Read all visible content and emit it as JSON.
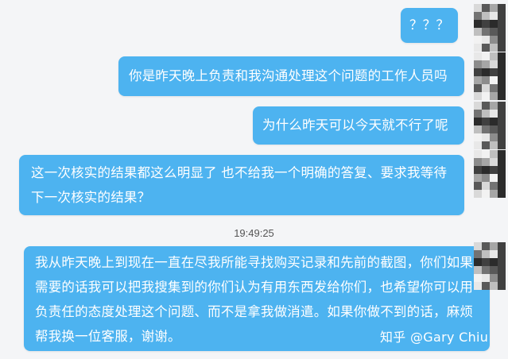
{
  "messages": [
    {
      "text": "？？？",
      "side": "right"
    },
    {
      "text": "你是昨天晚上负责和我沟通处理这个问题的工作人员吗",
      "side": "right"
    },
    {
      "text": "为什么昨天可以今天就不行了呢",
      "side": "right"
    },
    {
      "text": "这一次核实的结果都这么明显了 也不给我一个明确的答复、要求我等待下一次核实的结果？",
      "side": "right"
    },
    {
      "text": "我从昨天晚上到现在一直在尽我所能寻找购买记录和先前的截图，你们如果需要的话我可以把我搜集到的你们认为有用东西发给你们，也希望你可以用负责任的态度处理这个问题、而不是拿我做消遣。如果你做不到的话，麻烦帮我换一位客服，谢谢。",
      "side": "right"
    }
  ],
  "timestamp": "19:49:25",
  "watermark": "知乎 @Gary Chiu",
  "colors": {
    "bubble": "#4db3f0",
    "background": "#f4f5f7",
    "bubble_text": "#ffffff"
  }
}
